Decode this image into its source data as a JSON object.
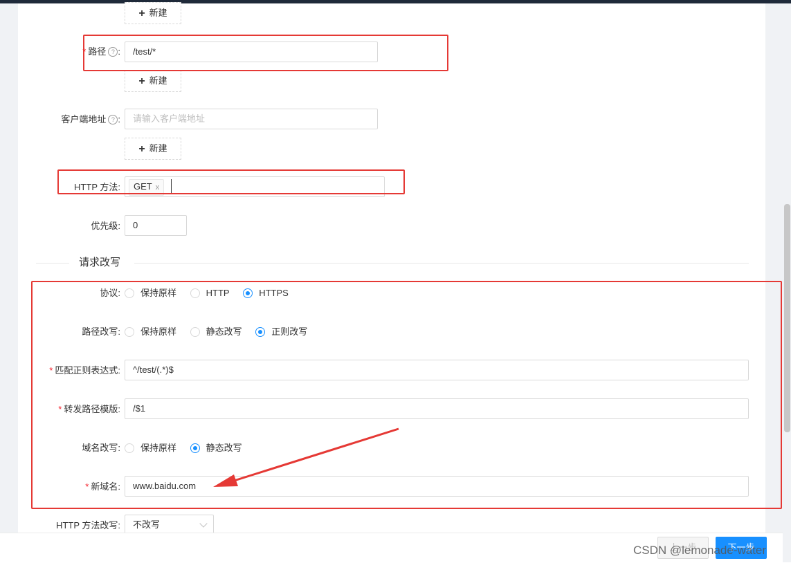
{
  "buttons": {
    "add_label": "新建",
    "prev_label": "上一步",
    "next_label": "下一步"
  },
  "fields": {
    "path": {
      "label": "路径",
      "value": "/test/*"
    },
    "client_address": {
      "label": "客户端地址",
      "placeholder": "请输入客户端地址"
    },
    "http_method": {
      "label": "HTTP 方法",
      "tag": "GET"
    },
    "priority": {
      "label": "优先级",
      "value": "0"
    }
  },
  "rewrite": {
    "section_title": "请求改写",
    "protocol": {
      "label": "协议",
      "options": [
        "保持原样",
        "HTTP",
        "HTTPS"
      ],
      "selected": "HTTPS"
    },
    "path_rewrite": {
      "label": "路径改写",
      "options": [
        "保持原样",
        "静态改写",
        "正则改写"
      ],
      "selected": "正则改写"
    },
    "regex": {
      "label": "匹配正则表达式",
      "value": "^/test/(.*)$"
    },
    "forward_template": {
      "label": "转发路径模版",
      "value": "/$1"
    },
    "domain_rewrite": {
      "label": "域名改写",
      "options": [
        "保持原样",
        "静态改写"
      ],
      "selected": "静态改写"
    },
    "new_domain": {
      "label": "新域名",
      "value": "www.baidu.com"
    },
    "http_method_rewrite": {
      "label": "HTTP 方法改写",
      "value": "不改写"
    }
  },
  "watermark": "CSDN @lemonade-water",
  "annotation_color": "#e53935",
  "accent_color": "#1890ff"
}
